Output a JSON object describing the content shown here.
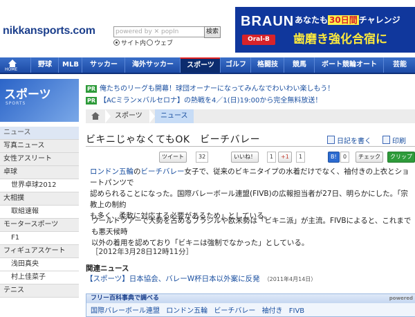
{
  "header": {
    "logo": "nikkansports.com",
    "search_placeholder": "powered by ✕ popIn",
    "search_button": "検索",
    "radio_site": "サイト内",
    "radio_web": "ウェブ"
  },
  "ad": {
    "brand": "BRAUN",
    "subbrand": "Oral-B",
    "line1_pre": "あなたも",
    "line1_hl": "30日間",
    "line1_post": "チャレンジ",
    "line2": "歯磨き強化合宿に"
  },
  "nav": {
    "home_label": "HOME",
    "items": [
      "野球",
      "MLB",
      "サッカー",
      "海外サッカー",
      "スポーツ",
      "ゴルフ",
      "格闘技",
      "競馬",
      "ボート競輪オート",
      "芸能"
    ]
  },
  "sidebar": {
    "title": "スポーツ",
    "subtitle": "SPORTS",
    "items": [
      "ニュース",
      "写真ニュース",
      "女性アスリート",
      "卓球",
      "世界卓球2012",
      "大相撲",
      "取組速報",
      "モータースポーツ",
      "F1",
      "フィギュアスケート",
      "浅田真央",
      "村上佳菜子",
      "テニス"
    ]
  },
  "pr": {
    "tag": "PR",
    "line1": "俺たちのリーグも開幕！球団オーナーになってみんなでわいわい楽しもう！",
    "line2": "【ACミラン×バルセロナ】の熱戦を4／1(日)19:00から完全無料放送！"
  },
  "breadcrumb": {
    "items": [
      "スポーツ",
      "ニュース"
    ]
  },
  "article": {
    "headline": "ビキニじゃなくてもOK　ビーチバレー",
    "tool_bookmark": "日記を書く",
    "tool_print": "印刷",
    "share_tweet": "ツイート",
    "tweet_count": "32",
    "share_like": "いいね！",
    "like_count": "1",
    "share_gplus": "+1",
    "gplus_count": "1",
    "share_hatena": "B!",
    "hatena_count": "0",
    "share_check": "チェック",
    "share_clip": "クリップ",
    "p1_link1": "ロンドン五輪",
    "p1_link2": "ビーチバレー",
    "p1_line1": "女子で、従来のビキニタイプの水着だけでなく、袖付きの上衣とショートパンツで",
    "p1_line2": "認められることになった。国際バレーボール連盟(FIVB)の広報担当者が27日、明らかにした。「宗教上の制約",
    "p1_line3": "も多く、柔軟に対応する必要があるため」としている。",
    "p2_line1": "ワールドツアーで大勢を占めるブラジルや欧米勢は「ビキニ派」が主流。FIVBによると、これまでも悪天候時",
    "p2_line2": "以外の着用を認めており「ビキニは強制でなかった」としている。",
    "dateline": "［2012年3月28日12時11分］",
    "related_title": "関連ニュース",
    "related_link": "【スポーツ】日本協会、バレーW杯日本以外案に反発",
    "related_date": "（2011年4月14日）"
  },
  "dictionary": {
    "title": "フリー百科事典で調べる",
    "powered": "powered",
    "terms": [
      "国際バレーボール連盟",
      "ロンドン五輪",
      "ビーチバレー",
      "袖付き",
      "FIVB"
    ]
  }
}
